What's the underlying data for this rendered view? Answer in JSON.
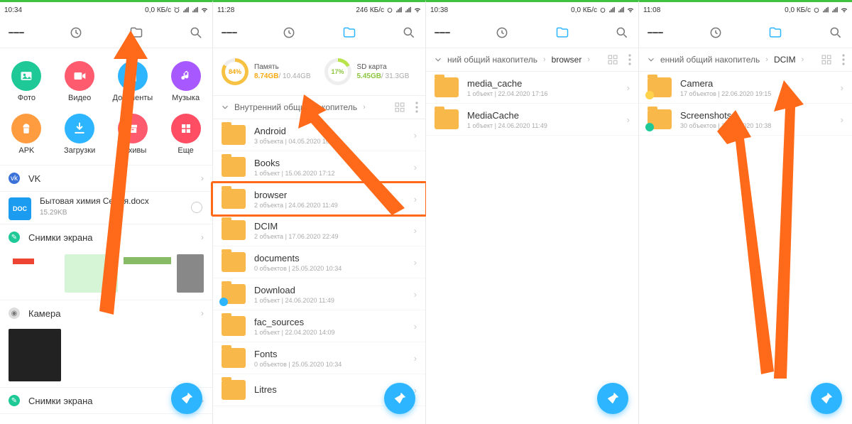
{
  "colors": {
    "photo": "#1ec997",
    "video": "#ff5b6e",
    "docs": "#2db5ff",
    "music": "#a858ff",
    "apk": "#ff9c40",
    "download": "#2db5ff",
    "archive": "#ff5b6e",
    "more": "#ff4d63",
    "fab": "#2db5ff",
    "accent": "#ff6a1a",
    "donut1": "#f7c143",
    "donut2": "#b9e34b"
  },
  "screens": [
    {
      "status": {
        "time": "10:34",
        "net": "0,0 КБ/с"
      },
      "categories": [
        {
          "label": "Фото",
          "color": "photo"
        },
        {
          "label": "Видео",
          "color": "video"
        },
        {
          "label": "Документы",
          "color": "docs"
        },
        {
          "label": "Музыка",
          "color": "music"
        },
        {
          "label": "APK",
          "color": "apk"
        },
        {
          "label": "Загрузки",
          "color": "download"
        },
        {
          "label": "Архивы",
          "color": "archive"
        },
        {
          "label": "Еще",
          "color": "more"
        }
      ],
      "recent": [
        {
          "type": "section",
          "label": "VK",
          "dot": "#3b72d9"
        },
        {
          "type": "file",
          "name": "Бытовая химия Семья.docx",
          "meta": "15.29KB"
        },
        {
          "type": "section",
          "label": "Снимки экрана",
          "dot": "#1ec997"
        },
        {
          "type": "thumbs"
        },
        {
          "type": "section",
          "label": "Камера",
          "dot": "#bbbbbb"
        },
        {
          "type": "camera"
        },
        {
          "type": "section",
          "label": "Снимки экрана",
          "dot": "#1ec997"
        }
      ]
    },
    {
      "status": {
        "time": "11:28",
        "net": "246 КБ/с"
      },
      "storage": [
        {
          "pct": "84%",
          "pctColor": "donut1",
          "label": "Память",
          "used": "8.74GB",
          "usedColor": "#f7a90f",
          "total": "/ 10.44GB"
        },
        {
          "pct": "17%",
          "pctColor": "donut2",
          "label": "SD карта",
          "used": "5.45GB",
          "usedColor": "#8cc63f",
          "total": "/ 31.3GB"
        }
      ],
      "breadcrumb": [
        "Внутренний общий накопитель"
      ],
      "folders": [
        {
          "name": "Android",
          "meta": "3 объекта  |  04.05.2020 10:07"
        },
        {
          "name": "Books",
          "meta": "1 объект  |  15.06.2020 17:12"
        },
        {
          "name": "browser",
          "meta": "2 объекта  |  24.06.2020 11:49",
          "highlight": true
        },
        {
          "name": "DCIM",
          "meta": "2 объекта  |  17.06.2020 22:49"
        },
        {
          "name": "documents",
          "meta": "0 объектов  |  25.05.2020 10:34"
        },
        {
          "name": "Download",
          "meta": "1 объект  |  24.06.2020 11:49",
          "badge": "#2db5ff"
        },
        {
          "name": "fac_sources",
          "meta": "1 объект  |  22.04.2020 14:09"
        },
        {
          "name": "Fonts",
          "meta": "0 объектов  |  25.05.2020 10:34"
        },
        {
          "name": "Litres",
          "meta": ""
        }
      ]
    },
    {
      "status": {
        "time": "10:38",
        "net": "0,0 КБ/с"
      },
      "breadcrumb": [
        "ний общий накопитель",
        "browser"
      ],
      "folders": [
        {
          "name": "media_cache",
          "meta": "1 объект  |  22.04.2020 17:16"
        },
        {
          "name": "MediaCache",
          "meta": "1 объект  |  24.06.2020 11:49"
        }
      ]
    },
    {
      "status": {
        "time": "11:08",
        "net": "0,0 КБ/с"
      },
      "breadcrumb": [
        "енний общий накопитель",
        "DCIM"
      ],
      "folders": [
        {
          "name": "Camera",
          "meta": "17 объектов  |  22.06.2020 19:15",
          "badge": "#ffd24c"
        },
        {
          "name": "Screenshots",
          "meta": "30 объектов  |  25.06.2020 10:38",
          "badge": "#1ec997"
        }
      ]
    }
  ]
}
